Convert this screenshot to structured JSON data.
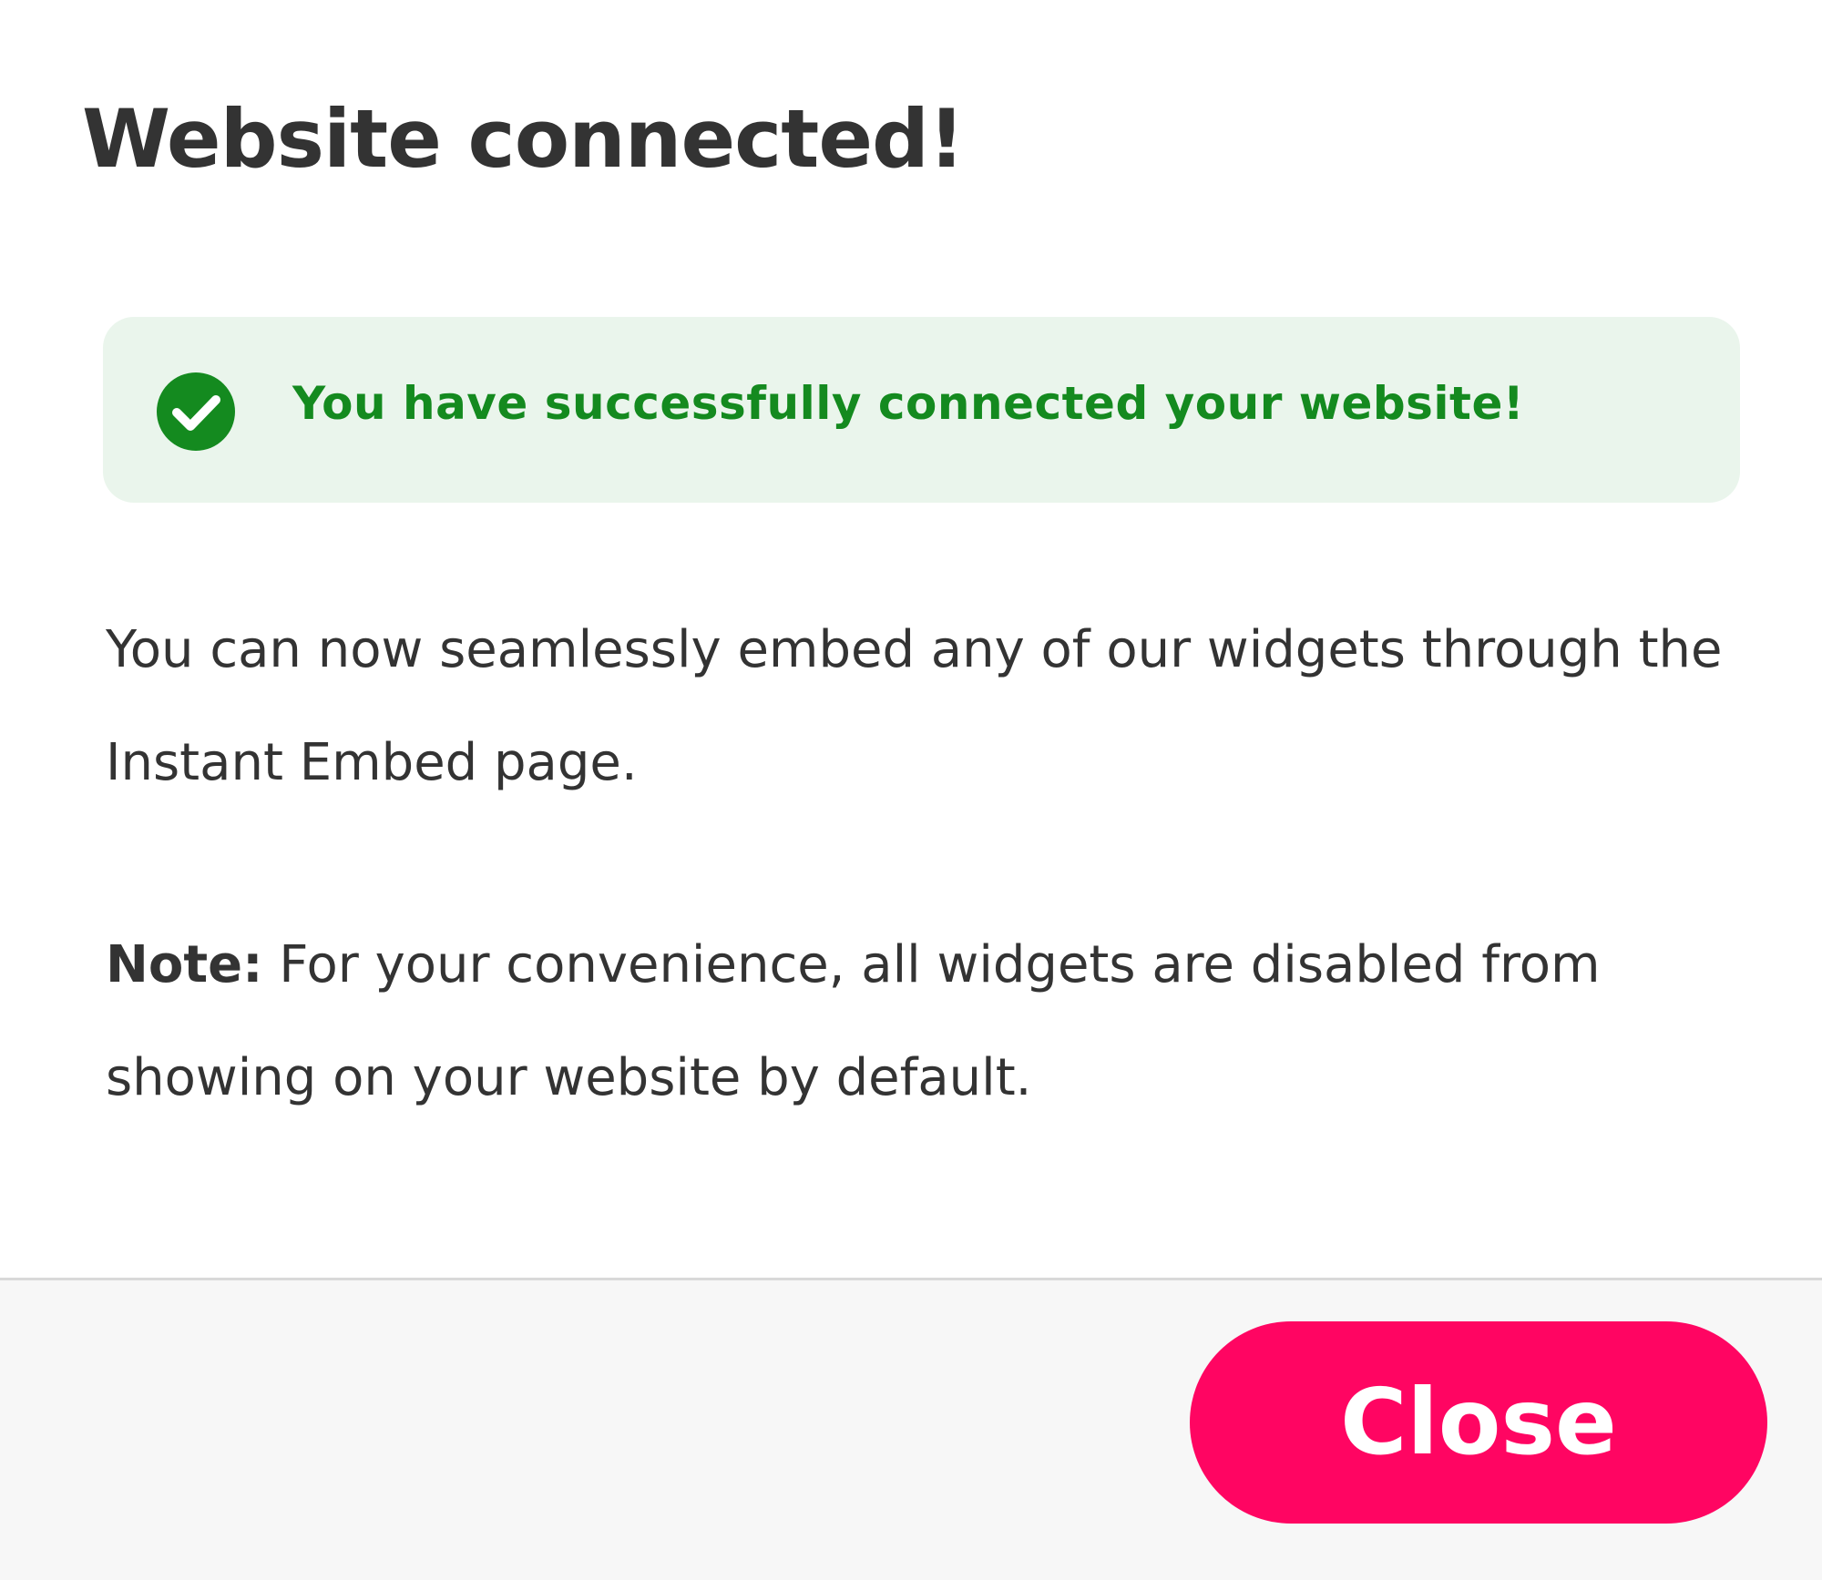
{
  "dialog": {
    "title": "Website connected!",
    "alert": {
      "icon": "check-circle-icon",
      "message": "You have successfully connected your website!",
      "background_color": "#eaf5ec",
      "text_color": "#148a1f"
    },
    "body_text": "You can now seamlessly embed any of our widgets through the Instant Embed page.",
    "note": {
      "label": "Note:",
      "text": " For your convenience, all widgets are disabled from showing on your website by default."
    }
  },
  "footer": {
    "close_label": "Close",
    "close_color": "#ff0562"
  }
}
